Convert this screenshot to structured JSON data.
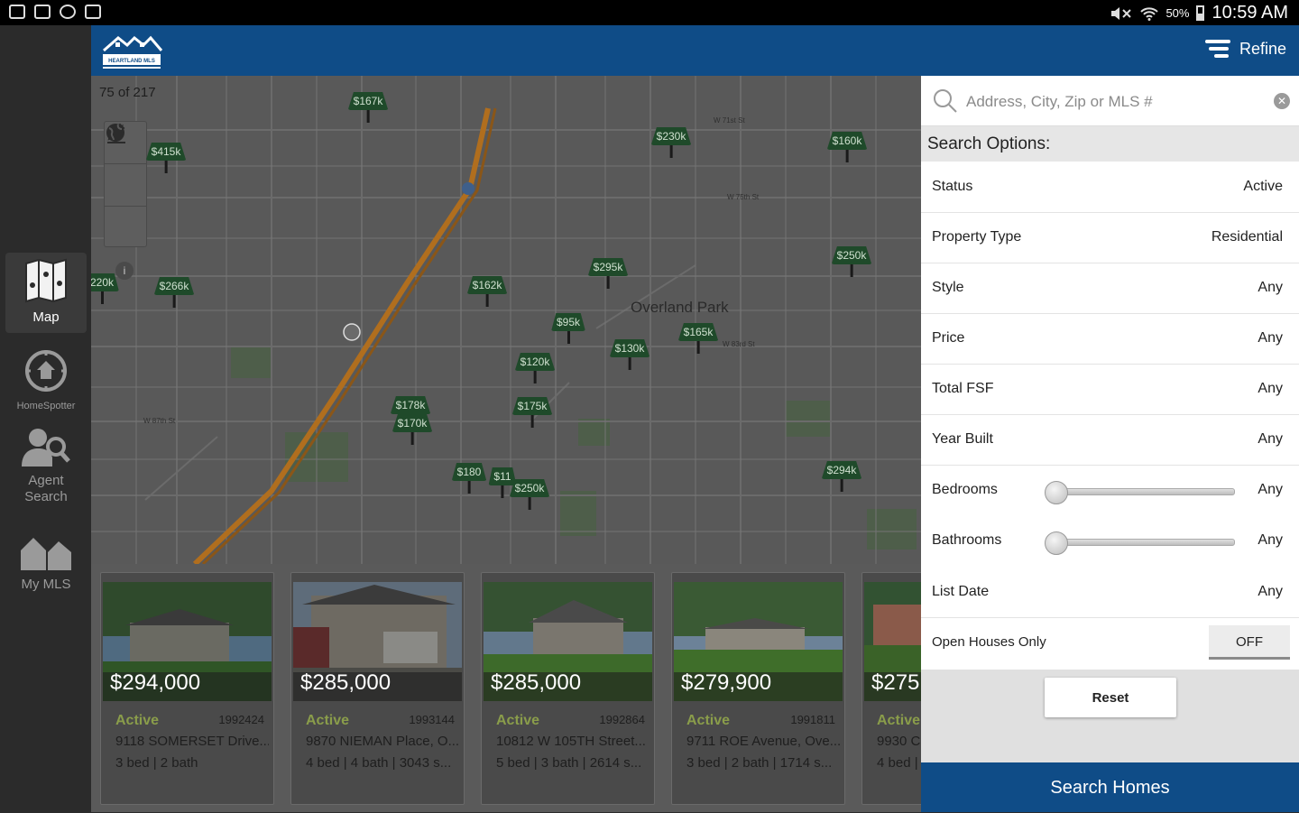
{
  "status_bar": {
    "battery": "50%",
    "time": "10:59 AM"
  },
  "nav": [
    {
      "label": "Map",
      "icon": "map-icon"
    },
    {
      "label": "HomeSpotter",
      "icon": "homespotter-icon"
    },
    {
      "label": "Agent Search",
      "icon": "agent-search-icon"
    },
    {
      "label": "My MLS",
      "icon": "my-mls-icon"
    }
  ],
  "header": {
    "logo_text": "HEARTLAND MLS",
    "refine_label": "Refine"
  },
  "map": {
    "count_label": "75 of 217",
    "city_label": "Overland Park",
    "pins": [
      {
        "label": "$167k"
      },
      {
        "label": "$415k"
      },
      {
        "label": "$230k"
      },
      {
        "label": "$160k"
      },
      {
        "label": "$250k"
      },
      {
        "label": "220k"
      },
      {
        "label": "$266k"
      },
      {
        "label": "$162k"
      },
      {
        "label": "$295k"
      },
      {
        "label": "$95k"
      },
      {
        "label": "$165k"
      },
      {
        "label": "$130k"
      },
      {
        "label": "$120k"
      },
      {
        "label": "$175k"
      },
      {
        "label": "$178k"
      },
      {
        "label": "$170k"
      },
      {
        "label": "$294k"
      },
      {
        "label": "$180"
      },
      {
        "label": "$11"
      },
      {
        "label": "$250k"
      }
    ]
  },
  "listings": [
    {
      "price": "$294,000",
      "status": "Active",
      "mls": "1992424",
      "address": "9118 SOMERSET Drive...",
      "details": "3 bed | 2 bath"
    },
    {
      "price": "$285,000",
      "status": "Active",
      "mls": "1993144",
      "address": "9870 NIEMAN Place, O...",
      "details": "4 bed | 4 bath | 3043 s..."
    },
    {
      "price": "$285,000",
      "status": "Active",
      "mls": "1992864",
      "address": "10812 W 105TH Street...",
      "details": "5 bed | 3 bath | 2614 s..."
    },
    {
      "price": "$279,900",
      "status": "Active",
      "mls": "1991811",
      "address": "9711 ROE Avenue, Ove...",
      "details": "3 bed | 2 bath | 1714 s..."
    },
    {
      "price": "$275",
      "status": "Active",
      "mls": "",
      "address": "9930 C",
      "details": "4 bed |"
    }
  ],
  "search": {
    "placeholder": "Address, City, Zip or MLS #",
    "options_title": "Search Options:",
    "options": [
      {
        "label": "Status",
        "value": "Active"
      },
      {
        "label": "Property Type",
        "value": "Residential"
      },
      {
        "label": "Style",
        "value": "Any"
      },
      {
        "label": "Price",
        "value": "Any"
      },
      {
        "label": "Total FSF",
        "value": "Any"
      },
      {
        "label": "Year Built",
        "value": "Any"
      },
      {
        "label": "Bedrooms",
        "value": "Any",
        "slider": 0
      },
      {
        "label": "Bathrooms",
        "value": "Any",
        "slider": 0
      },
      {
        "label": "List Date",
        "value": "Any"
      }
    ],
    "open_houses_label": "Open Houses Only",
    "open_houses_value": "OFF",
    "reset_label": "Reset",
    "search_label": "Search Homes"
  },
  "colors": {
    "header_blue": "#0f4c87",
    "pin_green": "#1f4a2a",
    "status_green": "#8a9d4a"
  }
}
